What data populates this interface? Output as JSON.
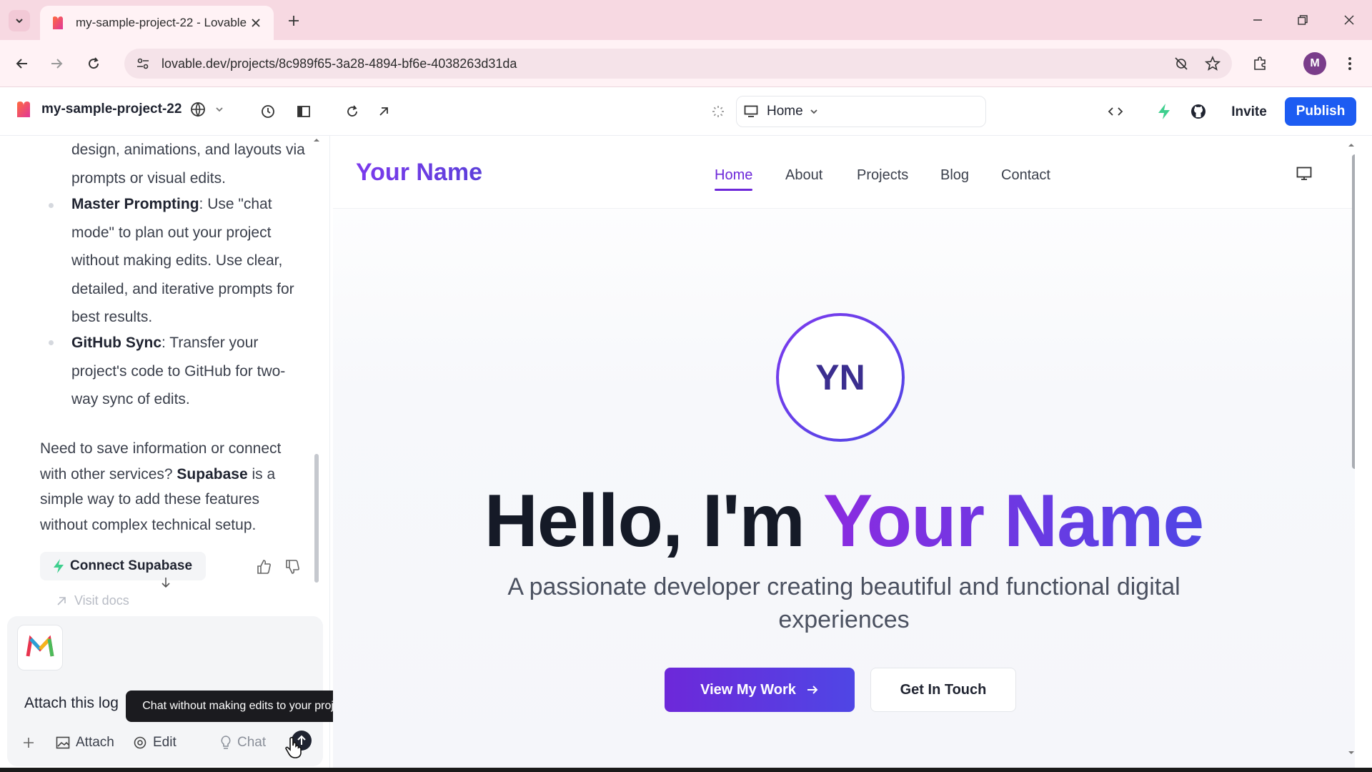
{
  "browser": {
    "tab_title": "my-sample-project-22 - Lovable",
    "url": "lovable.dev/projects/8c989f65-3a28-4894-bf6e-4038263d31da",
    "profile_initial": "M"
  },
  "app": {
    "project_name": "my-sample-project-22",
    "route": "Home",
    "invite_label": "Invite",
    "publish_label": "Publish",
    "accent_color": "#1d5cf2"
  },
  "chat": {
    "bullet1_tail": "design, animations, and layouts via prompts or visual edits.",
    "bullet2_title": "Master Prompting",
    "bullet2_text": ": Use \"chat mode\" to plan out your project without making edits. Use clear, detailed, and iterative prompts for best results.",
    "bullet3_title": "GitHub Sync",
    "bullet3_text": ": Transfer your project's code to GitHub for two-way sync of edits.",
    "para_pre": "Need to save information or connect with other services? ",
    "para_bold": "Supabase",
    "para_post": " is a simple way to add these features without complex technical setup.",
    "connect_label": "Connect Supabase",
    "visit_docs_label": "Visit docs",
    "composer_text": "Attach this log",
    "tooltip": "Chat without making edits to your project.",
    "attach_label": "Attach",
    "edit_label": "Edit",
    "chat_label": "Chat"
  },
  "site": {
    "brand": "Your Name",
    "nav": [
      "Home",
      "About",
      "Projects",
      "Blog",
      "Contact"
    ],
    "active_nav": "Home",
    "initials": "YN",
    "hero_prefix": "Hello, I'm ",
    "hero_name": "Your Name",
    "subtitle": "A passionate developer creating beautiful and functional digital experiences",
    "cta_primary": "View My Work",
    "cta_secondary": "Get In Touch"
  }
}
